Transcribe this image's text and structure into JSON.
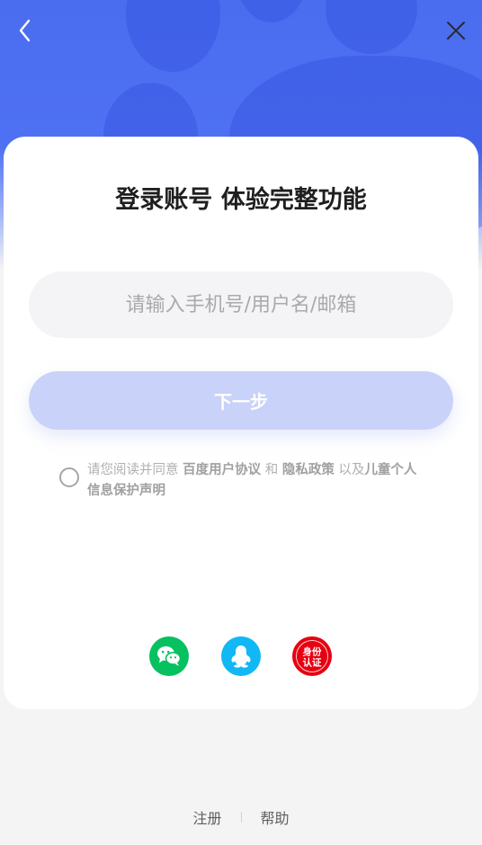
{
  "login": {
    "title": "登录账号 体验完整功能",
    "account_placeholder": "请输入手机号/用户名/邮箱",
    "next_label": "下一步"
  },
  "agreement": {
    "prefix": "请您阅读并同意 ",
    "user_agreement": "百度用户协议",
    "and": " 和 ",
    "privacy_policy": "隐私政策",
    "and2": " 以及",
    "children_privacy": "儿童个人信息保护声明"
  },
  "social_login": {
    "id_badge_text": "身份认证"
  },
  "footer": {
    "register": "注册",
    "help": "帮助"
  },
  "colors": {
    "brand_blue": "#4a6df0",
    "next_button_disabled": "#c9d2f8",
    "wechat_green": "#07c160",
    "qq_blue": "#12b7f5",
    "id_red": "#e60012"
  },
  "icons": {
    "back": "back-chevron-icon",
    "close": "close-icon",
    "wechat": "wechat-icon",
    "qq": "qq-penguin-icon",
    "id": "id-verification-icon"
  }
}
